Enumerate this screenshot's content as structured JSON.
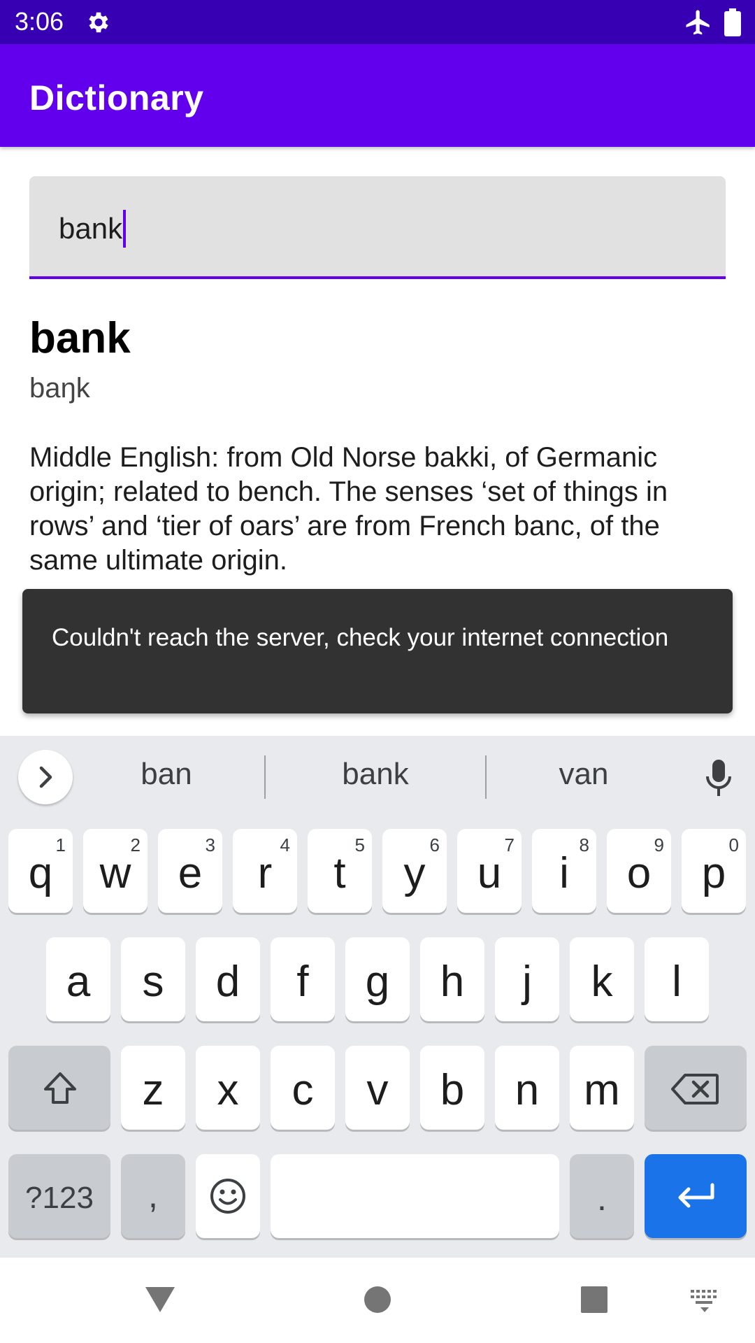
{
  "status_bar": {
    "time": "3:06"
  },
  "app_bar": {
    "title": "Dictionary"
  },
  "search": {
    "value": "bank"
  },
  "result": {
    "word": "bank",
    "phonetic": "baŋk",
    "origin": "Middle English: from Old Norse bakki, of Germanic origin; related to bench. The senses ‘set of things in rows’ and ‘tier of oars’ are from French banc, of the same ultimate origin."
  },
  "snackbar": {
    "message": "Couldn't reach the server, check your internet connection"
  },
  "keyboard": {
    "suggestions": [
      "ban",
      "bank",
      "van"
    ],
    "row1": [
      {
        "char": "q",
        "hint": "1"
      },
      {
        "char": "w",
        "hint": "2"
      },
      {
        "char": "e",
        "hint": "3"
      },
      {
        "char": "r",
        "hint": "4"
      },
      {
        "char": "t",
        "hint": "5"
      },
      {
        "char": "y",
        "hint": "6"
      },
      {
        "char": "u",
        "hint": "7"
      },
      {
        "char": "i",
        "hint": "8"
      },
      {
        "char": "o",
        "hint": "9"
      },
      {
        "char": "p",
        "hint": "0"
      }
    ],
    "row2": [
      "a",
      "s",
      "d",
      "f",
      "g",
      "h",
      "j",
      "k",
      "l"
    ],
    "row3": [
      "z",
      "x",
      "c",
      "v",
      "b",
      "n",
      "m"
    ],
    "symbols_label": "?123",
    "comma": ",",
    "period": "."
  },
  "icons": {
    "status": [
      "gear-icon",
      "airplane-mode-icon",
      "battery-icon"
    ],
    "keyboard": [
      "chevron-right-icon",
      "microphone-icon",
      "shift-icon",
      "backspace-icon",
      "emoji-icon",
      "enter-icon"
    ],
    "navigation": [
      "back-icon",
      "home-icon",
      "recents-icon",
      "keyboard-switch-icon"
    ]
  },
  "colors": {
    "status_bar": "#3700b3",
    "app_bar": "#6200ee",
    "snackbar": "#323232",
    "enter_key": "#1a73e8"
  }
}
